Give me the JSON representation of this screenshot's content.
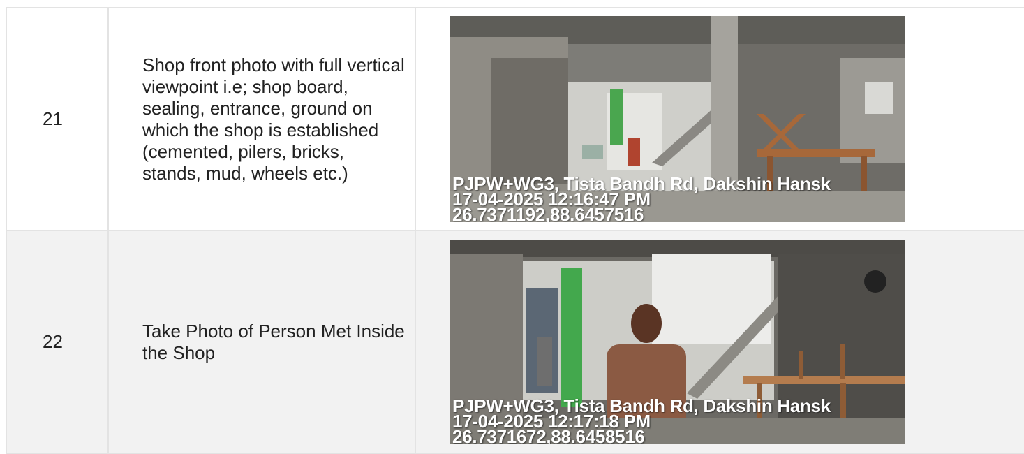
{
  "rows": [
    {
      "number": "21",
      "description": "Shop front photo with full vertical viewpoint i.e; shop board, sealing, entrance, ground on which the shop is established (cemented, pilers, bricks, stands, mud, wheels etc.)",
      "photo_stamp": {
        "address": "PJPW+WG3, Tista Bandh Rd, Dakshin Hansk",
        "datetime": "17-04-2025 12:16:47 PM",
        "coords": "26.7371192,88.6457516"
      }
    },
    {
      "number": "22",
      "description": "Take Photo of Person Met Inside the Shop",
      "photo_stamp": {
        "address": "PJPW+WG3, Tista Bandh Rd, Dakshin Hansk",
        "datetime": "17-04-2025 12:17:18 PM",
        "coords": "26.7371672,88.6458516"
      }
    }
  ],
  "colors": {
    "border": "#e3e3e3",
    "alt_row": "#f2f2f2",
    "stamp_text": "#ffffff"
  }
}
